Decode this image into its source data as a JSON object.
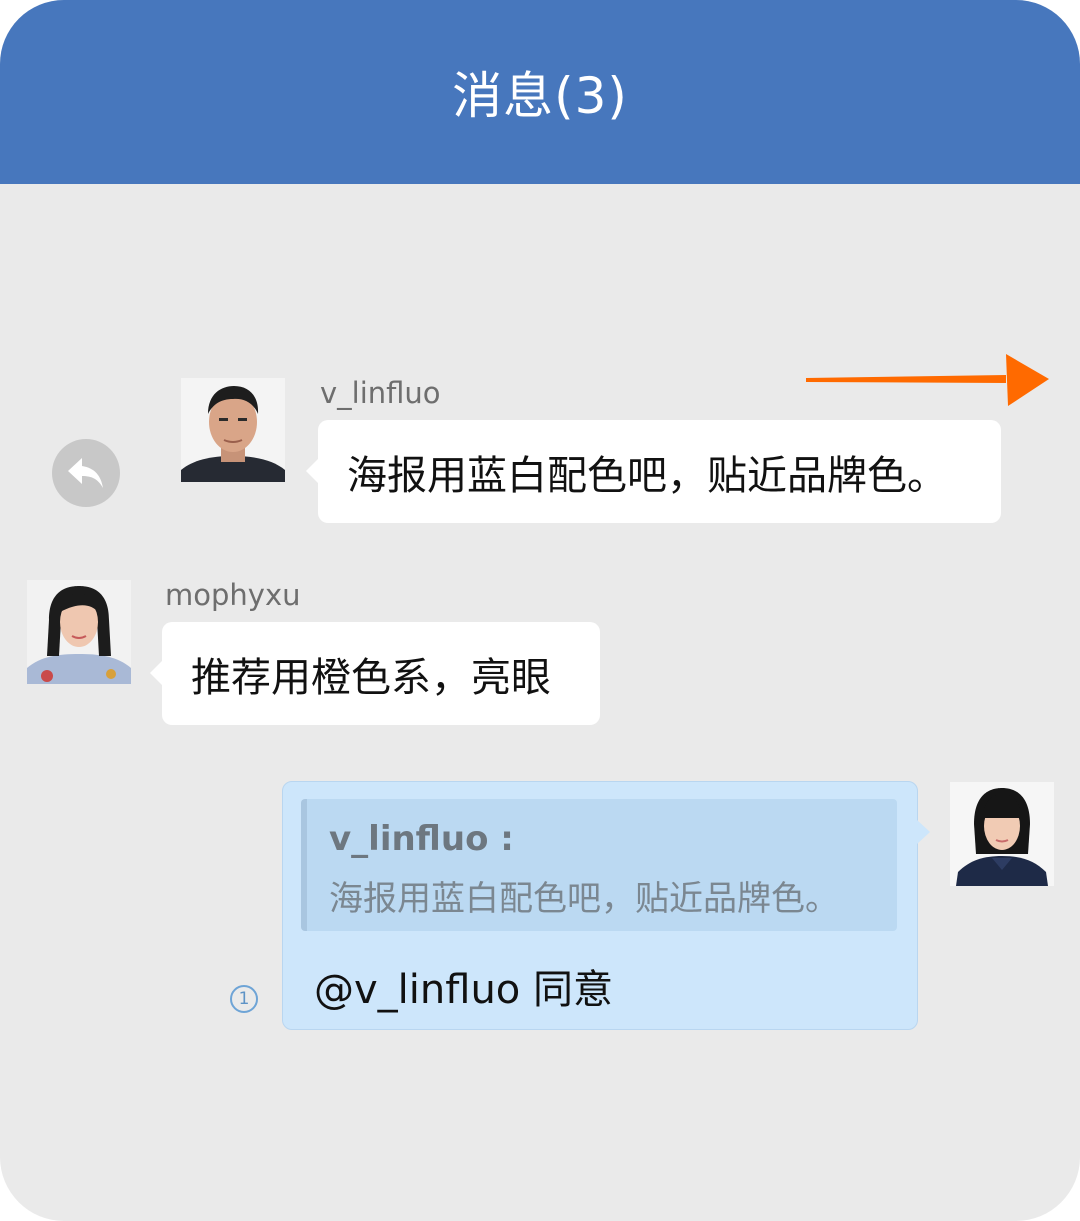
{
  "header": {
    "title": "消息(3)"
  },
  "messages": [
    {
      "sender": "v_linfluo",
      "text": "海报用蓝白配色吧，贴近品牌色。"
    },
    {
      "sender": "mophyxu",
      "text": "推荐用橙色系，亮眼"
    }
  ],
  "my_message": {
    "quote_sender": "v_linfluo :",
    "quote_text": "海报用蓝白配色吧，贴近品牌色。",
    "text": "@v_linfluo 同意",
    "read_count": "1"
  },
  "colors": {
    "header": "#4777bd",
    "background": "#eaeaea",
    "my_bubble": "#cde6fb",
    "arrow": "#ff6a00"
  },
  "icons": {
    "reply": "reply-arrow-icon",
    "annotation": "orange-arrow-icon"
  }
}
